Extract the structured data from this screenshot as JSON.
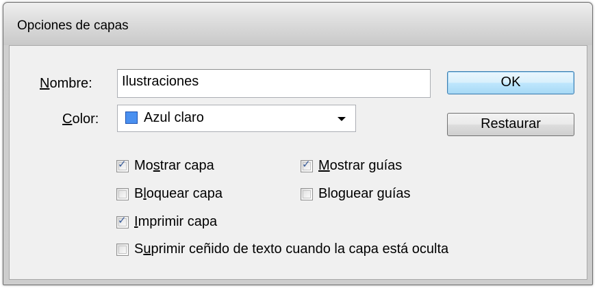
{
  "dialog": {
    "title": "Opciones de capas"
  },
  "fields": {
    "name": {
      "label_pre": "",
      "label_mnemonic": "N",
      "label_post": "ombre:",
      "value": "Ilustraciones"
    },
    "color": {
      "label_pre": "",
      "label_mnemonic": "C",
      "label_post": "olor:",
      "value": "Azul claro",
      "swatch_color": "#4a90f0"
    }
  },
  "buttons": {
    "ok": "OK",
    "reset": "Restaurar"
  },
  "options": {
    "show_layer": {
      "pre": "Mo",
      "mnemonic": "s",
      "post": "trar capa",
      "checked": true
    },
    "show_guides": {
      "pre": "",
      "mnemonic": "M",
      "post": "ostrar guías",
      "checked": true
    },
    "lock_layer": {
      "pre": "B",
      "mnemonic": "l",
      "post": "oquear capa",
      "checked": false
    },
    "lock_guides": {
      "pre": "Blo",
      "mnemonic": "g",
      "post": "uear guías",
      "checked": false
    },
    "print_layer": {
      "pre": "",
      "mnemonic": "I",
      "post": "mprimir capa",
      "checked": true
    },
    "suppress_wrap": {
      "pre": "S",
      "mnemonic": "u",
      "post": "primir ceñido de texto cuando la capa está oculta",
      "checked": false
    }
  }
}
